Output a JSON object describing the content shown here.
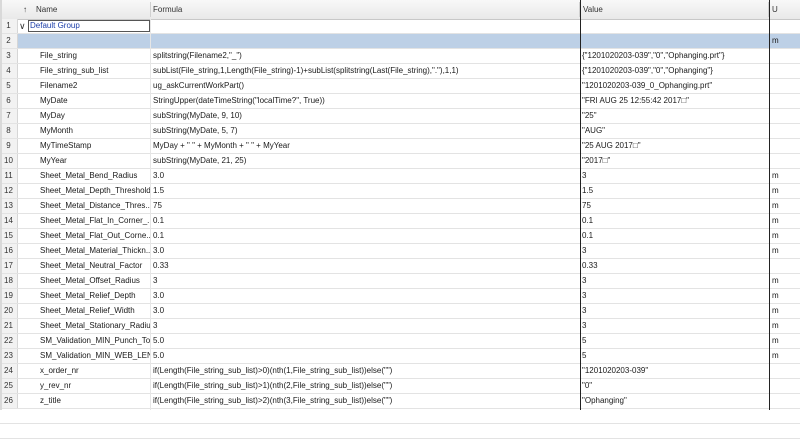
{
  "header": {
    "sort_icon": "↑",
    "name": "Name",
    "formula": "Formula",
    "value": "Value",
    "unit": "U"
  },
  "group": {
    "num": "1",
    "label": "Default Group"
  },
  "rows": [
    {
      "num": "2",
      "name": "",
      "formula": "",
      "value": "",
      "unit": "m",
      "selected": true
    },
    {
      "num": "3",
      "name": "File_string",
      "formula": "splitstring(Filename2,\"_\")",
      "value": "{\"1201020203-039\",\"0\",\"Ophanging.prt\"}",
      "unit": ""
    },
    {
      "num": "4",
      "name": "File_string_sub_list",
      "formula": "subList(File_string,1,Length(File_string)-1)+subList(splitstring(Last(File_string),\".\"),1,1)",
      "value": "{\"1201020203-039\",\"0\",\"Ophanging\"}",
      "unit": ""
    },
    {
      "num": "5",
      "name": "Filename2",
      "formula": "ug_askCurrentWorkPart()",
      "value": "\"1201020203-039_0_Ophanging.prt\"",
      "unit": ""
    },
    {
      "num": "6",
      "name": "MyDate",
      "formula": "StringUpper(dateTimeString(\"localTime?\", True))",
      "value": "\"FRI AUG 25 12:55:42 2017□\"",
      "unit": ""
    },
    {
      "num": "7",
      "name": "MyDay",
      "formula": "subString(MyDate, 9, 10)",
      "value": "\"25\"",
      "unit": ""
    },
    {
      "num": "8",
      "name": "MyMonth",
      "formula": "subString(MyDate, 5, 7)",
      "value": "\"AUG\"",
      "unit": ""
    },
    {
      "num": "9",
      "name": "MyTimeStamp",
      "formula": "MyDay + \" \" + MyMonth + \" \" + MyYear",
      "value": "\"25 AUG 2017□\"",
      "unit": ""
    },
    {
      "num": "10",
      "name": "MyYear",
      "formula": "subString(MyDate, 21, 25)",
      "value": "\"2017□\"",
      "unit": ""
    },
    {
      "num": "11",
      "name": "Sheet_Metal_Bend_Radius",
      "formula": "3.0",
      "value": "3",
      "unit": "m"
    },
    {
      "num": "12",
      "name": "Sheet_Metal_Depth_Threshold",
      "formula": "1.5",
      "value": "1.5",
      "unit": "m"
    },
    {
      "num": "13",
      "name": "Sheet_Metal_Distance_Thres...",
      "formula": "75",
      "value": "75",
      "unit": "m"
    },
    {
      "num": "14",
      "name": "Sheet_Metal_Flat_In_Corner_...",
      "formula": "0.1",
      "value": "0.1",
      "unit": "m"
    },
    {
      "num": "15",
      "name": "Sheet_Metal_Flat_Out_Corne...",
      "formula": "0.1",
      "value": "0.1",
      "unit": "m"
    },
    {
      "num": "16",
      "name": "Sheet_Metal_Material_Thickn...",
      "formula": "3.0",
      "value": "3",
      "unit": "m"
    },
    {
      "num": "17",
      "name": "Sheet_Metal_Neutral_Factor",
      "formula": "0.33",
      "value": "0.33",
      "unit": ""
    },
    {
      "num": "18",
      "name": "Sheet_Metal_Offset_Radius",
      "formula": "3",
      "value": "3",
      "unit": "m"
    },
    {
      "num": "19",
      "name": "Sheet_Metal_Relief_Depth",
      "formula": "3.0",
      "value": "3",
      "unit": "m"
    },
    {
      "num": "20",
      "name": "Sheet_Metal_Relief_Width",
      "formula": "3.0",
      "value": "3",
      "unit": "m"
    },
    {
      "num": "21",
      "name": "Sheet_Metal_Stationary_Radius",
      "formula": "3",
      "value": "3",
      "unit": "m"
    },
    {
      "num": "22",
      "name": "SM_Validation_MIN_Punch_To...",
      "formula": "5.0",
      "value": "5",
      "unit": "m"
    },
    {
      "num": "23",
      "name": "SM_Validation_MIN_WEB_LEN...",
      "formula": "5.0",
      "value": "5",
      "unit": "m"
    },
    {
      "num": "24",
      "name": "x_order_nr",
      "formula": "if(Length(File_string_sub_list)>0)(nth(1,File_string_sub_list))else(\"\")",
      "value": "\"1201020203-039\"",
      "unit": ""
    },
    {
      "num": "25",
      "name": "y_rev_nr",
      "formula": "if(Length(File_string_sub_list)>1)(nth(2,File_string_sub_list))else(\"\")",
      "value": "\"0\"",
      "unit": ""
    },
    {
      "num": "26",
      "name": "z_title",
      "formula": "if(Length(File_string_sub_list)>2)(nth(3,File_string_sub_list))else(\"\")",
      "value": "\"Ophanging\"",
      "unit": ""
    }
  ]
}
